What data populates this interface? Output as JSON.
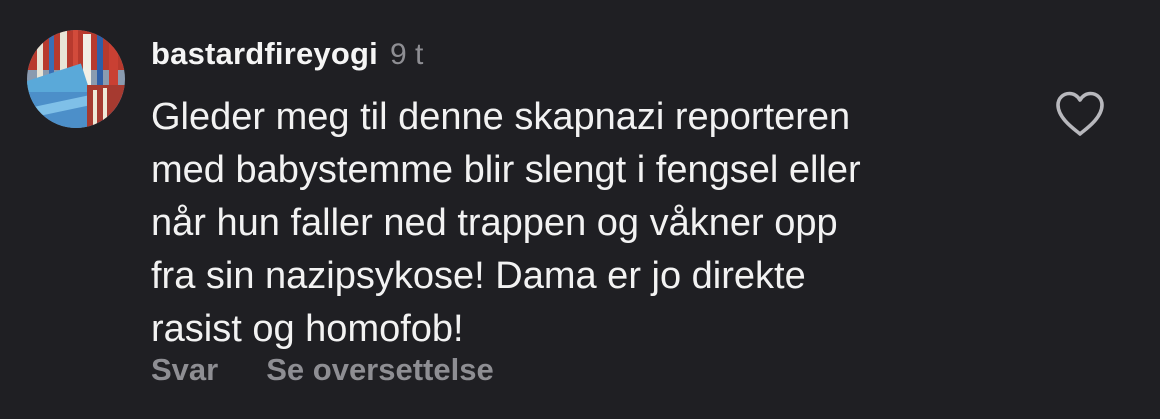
{
  "comment": {
    "username": "bastardfireyogi",
    "time": "9 t",
    "text_lines": [
      "Gleder meg til denne skapnazi reporteren",
      "med babystemme blir slengt i fengsel eller",
      "når hun faller ned trappen og våkner opp",
      "fra sin nazipsykose! Dama er jo direkte",
      "rasist og homofob!"
    ],
    "like_icon": "heart-outline-icon",
    "actions": {
      "reply": "Svar",
      "translate": "Se oversettelse"
    }
  },
  "colors": {
    "background": "#1f1f23",
    "text": "#f2f2f2",
    "secondary_text": "#8e8e93"
  }
}
